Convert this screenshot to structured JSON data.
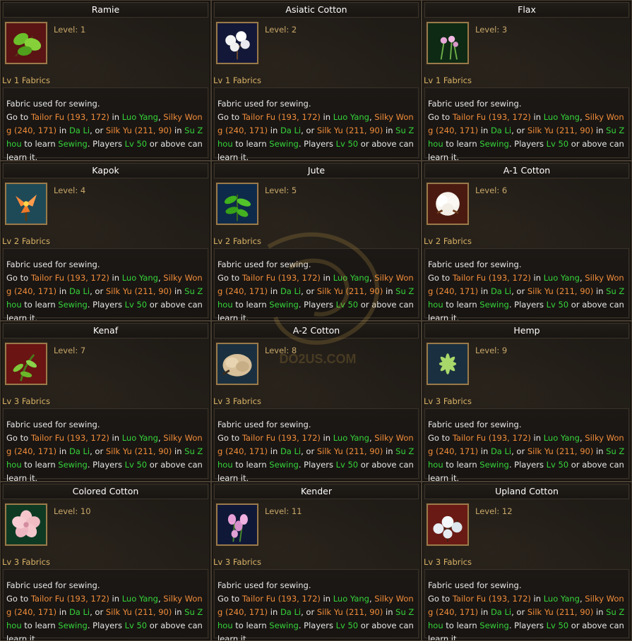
{
  "common": {
    "intro": "Fabric used for sewing.",
    "go_to": "Go to ",
    "npc1_name": "Tailor Fu (193, 172)",
    "in1": " in ",
    "city1": "Luo Yang",
    "sep1": ", ",
    "npc2_name": "Silky Wong (240, 171)",
    "in2": " in ",
    "city2": "Da Li",
    "sep2": ", or ",
    "npc3_name": "Silk Yu  (211, 90)",
    "in3": " in ",
    "city3": "Su Zhou",
    "to_learn": " to learn ",
    "skill": "Sewing",
    "players": ". Players ",
    "req_level": "Lv 50",
    "tail": " or above can learn it."
  },
  "colors": {
    "title": "#ffffff",
    "level": "#c9a86a",
    "fabric_label": "#d8b266",
    "npc": "#f08c3a",
    "place": "#35d43a",
    "border": "#4a4034",
    "background": "#1f1b16"
  },
  "watermark_text": "DO2US.COM",
  "items": [
    {
      "name": "Ramie",
      "level": "Level: 1",
      "fabric_level": "Lv 1 Fabrics",
      "icon": "ramie-leaf-icon"
    },
    {
      "name": "Asiatic Cotton",
      "level": "Level: 2",
      "fabric_level": "Lv 1 Fabrics",
      "icon": "cotton-boll-icon"
    },
    {
      "name": "Flax",
      "level": "Level: 3",
      "fabric_level": "Lv 1 Fabrics",
      "icon": "flax-flower-icon"
    },
    {
      "name": "Kapok",
      "level": "Level: 4",
      "fabric_level": "Lv 2 Fabrics",
      "icon": "kapok-flower-icon"
    },
    {
      "name": "Jute",
      "level": "Level: 5",
      "fabric_level": "Lv 2 Fabrics",
      "icon": "jute-leaf-icon"
    },
    {
      "name": "A-1 Cotton",
      "level": "Level: 6",
      "fabric_level": "Lv 2 Fabrics",
      "icon": "cotton-ball-icon"
    },
    {
      "name": "Kenaf",
      "level": "Level: 7",
      "fabric_level": "Lv 3 Fabrics",
      "icon": "kenaf-plant-icon"
    },
    {
      "name": "A-2 Cotton",
      "level": "Level: 8",
      "fabric_level": "Lv 3 Fabrics",
      "icon": "raw-cotton-icon"
    },
    {
      "name": "Hemp",
      "level": "Level: 9",
      "fabric_level": "Lv 3 Fabrics",
      "icon": "hemp-leaf-icon"
    },
    {
      "name": "Colored Cotton",
      "level": "Level: 10",
      "fabric_level": "Lv 3 Fabrics",
      "icon": "pink-flower-icon"
    },
    {
      "name": "Kender",
      "level": "Level: 11",
      "fabric_level": "Lv 3 Fabrics",
      "icon": "kender-flower-icon"
    },
    {
      "name": "Upland Cotton",
      "level": "Level: 12",
      "fabric_level": "Lv 3 Fabrics",
      "icon": "upland-cotton-icon"
    }
  ]
}
